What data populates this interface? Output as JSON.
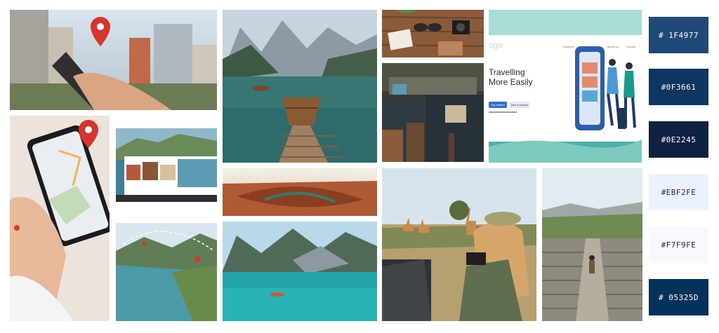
{
  "moodboard": {
    "palette": [
      {
        "hex": "#1F4977",
        "label": "# 1F4977",
        "text_color": "#ffffff"
      },
      {
        "hex": "#0F3661",
        "label": "#0F3661",
        "text_color": "#ffffff"
      },
      {
        "hex": "#0E2245",
        "label": "#0E2245",
        "text_color": "#ffffff"
      },
      {
        "hex": "#EBF2FE",
        "label": "#EBF2FE",
        "text_color": "#2b2b2b"
      },
      {
        "hex": "#F7F9FE",
        "label": "#F7F9FE",
        "text_color": "#2b2b2b"
      },
      {
        "hex": "#05325D",
        "label": "# 05325D",
        "text_color": "#ffffff"
      }
    ],
    "website_mockup": {
      "logo_text": "ogo",
      "headline_line1": "Travelling",
      "headline_line2": "More Easily",
      "primary_button": "Get started",
      "secondary_button": "See a sample",
      "nav_items": [
        "Solutions",
        "API",
        "Demo",
        "About Us",
        "Contact"
      ]
    }
  }
}
